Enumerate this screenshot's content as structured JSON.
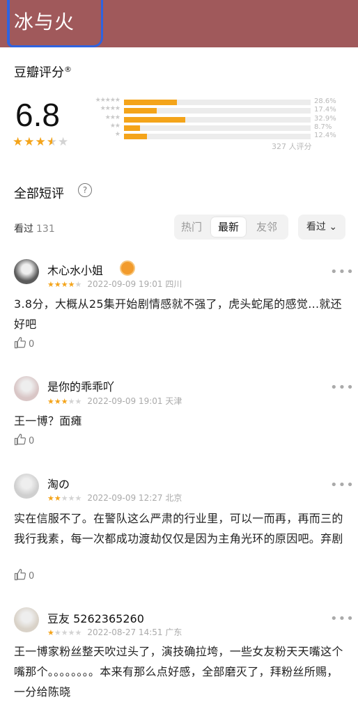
{
  "header": {
    "title": "冰与火"
  },
  "rating": {
    "section_title": "豆瓣评分",
    "section_mark": "®",
    "score": "6.8",
    "score_stars": 3.5,
    "distribution": [
      {
        "stars": 5,
        "percent": 28.6,
        "label": "28.6%"
      },
      {
        "stars": 4,
        "percent": 17.4,
        "label": "17.4%"
      },
      {
        "stars": 3,
        "percent": 32.9,
        "label": "32.9%"
      },
      {
        "stars": 2,
        "percent": 8.7,
        "label": "8.7%"
      },
      {
        "stars": 1,
        "percent": 12.4,
        "label": "12.4%"
      }
    ],
    "total_label": "327 人评分"
  },
  "reviews_section": {
    "title": "全部短评",
    "help_icon": "question-circle-icon",
    "seen_label": "看过",
    "seen_count": "131",
    "tabs": [
      "热门",
      "最新",
      "友邻"
    ],
    "active_tab": "最新",
    "filter_label": "看过"
  },
  "reviews": [
    {
      "user": "木心水小姐",
      "stars": 4,
      "time": "2022-09-09 19:01",
      "location": "四川",
      "text": "3.8分，大概从25集开始剧情感就不强了，虎头蛇尾的感觉...就还好吧",
      "likes": "0",
      "avatar_color": "#5b5b5b",
      "has_badge": true
    },
    {
      "user": "是你的乖乖吖",
      "stars": 3,
      "time": "2022-09-09 19:01",
      "location": "天津",
      "text": "王一博？面瘫",
      "likes": "0",
      "avatar_color": "#d9c6c6"
    },
    {
      "user": "淘の",
      "stars": 2,
      "time": "2022-09-09 12:27",
      "location": "北京",
      "text": "实在信服不了。在警队这么严肃的行业里，可以一而再，再而三的我行我素，每一次都成功渡劫仅仅是因为主角光环的原因吧。弃剧",
      "likes": "0",
      "avatar_color": "#cfcfcf"
    },
    {
      "user": "豆友 5262365260",
      "stars": 1,
      "time": "2022-08-27 14:51",
      "location": "广东",
      "text": "王一博家粉丝整天吹过头了，演技确拉垮，一些女友粉天天嘴这个嘴那个。。。。。。。。本来有那么点好感，全部磨灭了，拜粉丝所赐，一分给陈晓",
      "likes": "",
      "avatar_color": "#d9d2c8"
    }
  ],
  "colors": {
    "header_bg": "#a0595b",
    "star": "#f4a41a",
    "accent_mark": "#2f63e0"
  }
}
